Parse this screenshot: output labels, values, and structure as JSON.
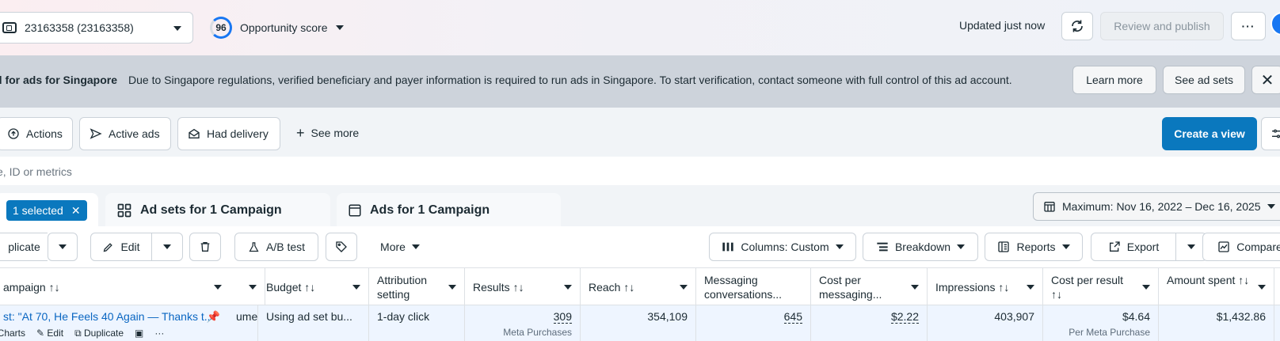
{
  "header": {
    "account_label": "23163358 (23163358)",
    "opportunity_score": "96",
    "opportunity_label": "Opportunity score",
    "updated_text": "Updated just now",
    "review_publish_label": "Review and publish",
    "more_label": "···"
  },
  "banner": {
    "title": "d for ads for Singapore",
    "text": "Due to Singapore regulations, verified beneficiary and payer information is required to run ads in Singapore. To start verification, contact someone with full control of this ad account.",
    "learn_more_label": "Learn more",
    "see_ad_sets_label": "See ad sets",
    "close_label": "✕"
  },
  "filters": {
    "actions_label": "Actions",
    "active_ads_label": "Active ads",
    "had_delivery_label": "Had delivery",
    "see_more_label": "See more",
    "create_view_label": "Create a view"
  },
  "search": {
    "placeholder": "e, ID or metrics"
  },
  "tabs": {
    "selected_label": "1 selected",
    "adsets_label": "Ad sets for 1 Campaign",
    "ads_label": "Ads for 1 Campaign",
    "date_range_label": "Maximum: Nov 16, 2022 – Dec 16, 2025"
  },
  "toolbar": {
    "duplicate_label": "plicate",
    "edit_label": "Edit",
    "ab_test_label": "A/B test",
    "more_label": "More",
    "columns_label": "Columns: Custom",
    "breakdown_label": "Breakdown",
    "reports_label": "Reports",
    "export_label": "Export",
    "compare_label": "Compare"
  },
  "table": {
    "headers": {
      "campaign": "ampaign ↑↓",
      "budget": "Budget ↑↓",
      "attribution": "Attribution setting",
      "results": "Results ↑↓",
      "reach": "Reach ↑↓",
      "messaging": "Messaging conversations...",
      "cost_messaging": "Cost per messaging...",
      "impressions": "Impressions ↑↓",
      "cost_result": "Cost per result ↑↓",
      "amount_spent": "Amount spent ↑↓"
    },
    "row": {
      "campaign_name": "st: \"At 70, He Feels 40 Again — Thanks t...",
      "row_actions": {
        "charts": "Charts",
        "edit": "Edit",
        "duplicate": "Duplicate",
        "more": "···"
      },
      "hidden_col": "ume",
      "budget": "Using ad set bu...",
      "attribution": "1-day click",
      "results": "309",
      "results_sub": "Meta Purchases",
      "reach": "354,109",
      "messaging": "645",
      "cost_messaging": "$2.22",
      "impressions": "403,907",
      "cost_result": "$4.64",
      "cost_result_sub": "Per Meta Purchase",
      "amount_spent": "$1,432.86"
    }
  }
}
